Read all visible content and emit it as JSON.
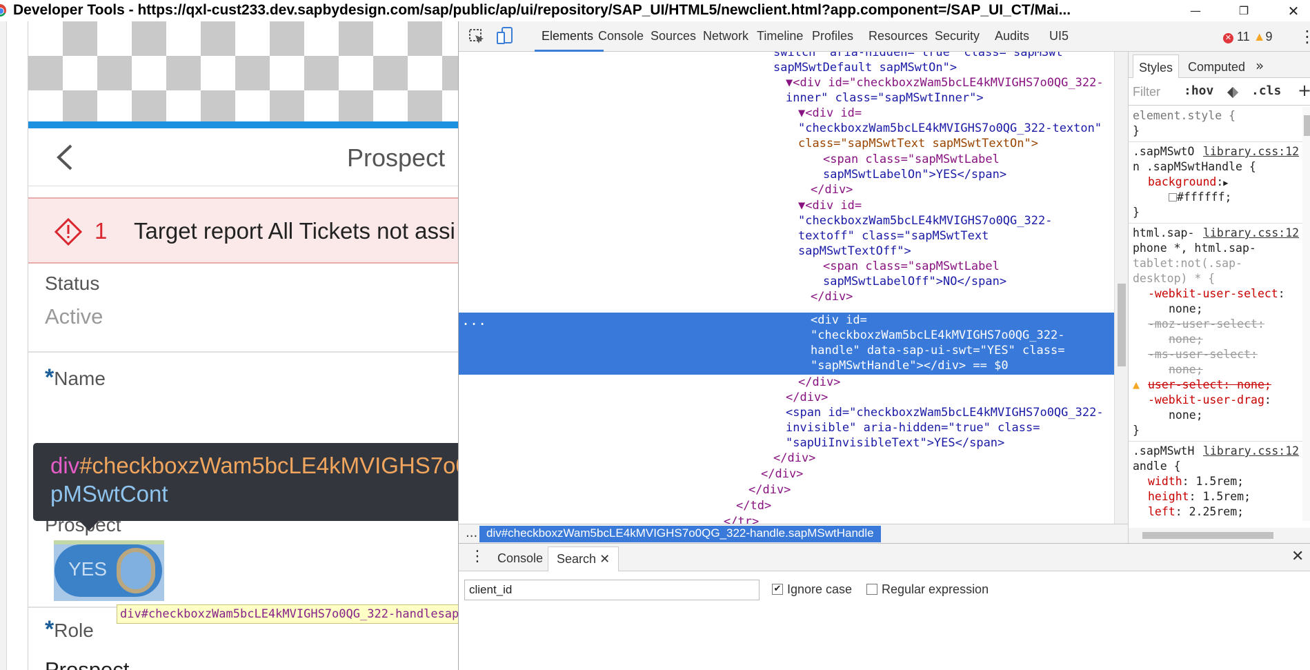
{
  "window": {
    "title": "Developer Tools - https://qxl-cust233.dev.sapbydesign.com/sap/public/ap/ui/repository/SAP_UI/HTML5/newclient.html?app.component=/SAP_UI_CT/Mai...",
    "controls": {
      "minimize": "—",
      "restore": "❐",
      "close": "✕"
    }
  },
  "page": {
    "title": "Prospect",
    "message": {
      "count": "1",
      "text": "Target report All Tickets not assi"
    },
    "fields": [
      {
        "label": "Status",
        "value": "Active"
      },
      {
        "label": "Name",
        "required_mark": "*"
      },
      {
        "label": "Prospect"
      },
      {
        "label": "Role",
        "required_mark": "*",
        "value": "Prospect"
      }
    ],
    "switch": {
      "label": "YES"
    },
    "tooltip": {
      "tag": "div",
      "id": "#checkboxzWam5bcLE4kMVIGHS7o0",
      "class_line": "pMSwtCont"
    },
    "node_label": "div#checkboxzWam5bcLE4kMVIGHS7o0QG_322-handlesap",
    "colors": {
      "accent": "#1b91e0",
      "error": "#d9252d",
      "switch": "#3c82c8"
    }
  },
  "devtools": {
    "tabs": [
      "Elements",
      "Console",
      "Sources",
      "Network",
      "Timeline",
      "Profiles",
      "Resources",
      "Security",
      "Audits",
      "UI5"
    ],
    "active_tab": "Elements",
    "errors": "11",
    "warnings": "9",
    "dom": {
      "l1a": "switch\" aria-hidden=\"true\" class=\"sapMSwt",
      "l1b": "sapMSwtDefault sapMSwtOn\">",
      "l2a": "▼<div id=\"checkboxzWam5bcLE4kMVIGHS7o0QG_322-",
      "l2b": "inner\" class=\"sapMSwtInner\">",
      "l3a": "▼<div id=",
      "l3b": "\"checkboxzWam5bcLE4kMVIGHS7o0QG_322-texton\"",
      "l3c": "class=\"sapMSwtText sapMSwtTextOn\">",
      "l4a": "<span class=\"sapMSwtLabel",
      "l4b": "sapMSwtLabelOn\">YES</span>",
      "l5": "</div>",
      "l6a": "▼<div id=",
      "l6b": "\"checkboxzWam5bcLE4kMVIGHS7o0QG_322-",
      "l6c": "textoff\" class=\"sapMSwtText",
      "l6d": "sapMSwtTextOff\">",
      "l7a": "<span class=\"sapMSwtLabel",
      "l7b": "sapMSwtLabelOff\">NO</span>",
      "l8": "</div>",
      "sel_a": "<div id=",
      "sel_b": "\"checkboxzWam5bcLE4kMVIGHS7o0QG_322-",
      "sel_c": "handle\" data-sap-ui-swt=\"YES\" class=",
      "sel_d": "\"sapMSwtHandle\"></div> == $0",
      "sel_dots": "...",
      "l9": "</div>",
      "l10": "</div>",
      "l11a": "<span id=\"checkboxzWam5bcLE4kMVIGHS7o0QG_322-",
      "l11b": "invisible\" aria-hidden=\"true\" class=",
      "l11c": "\"sapUiInvisibleText\">YES</span>",
      "l12": "</div>",
      "l13": "</div>",
      "l14": "</div>",
      "l15": "</td>",
      "l16": "</tr>"
    },
    "breadcrumb": {
      "dots": "...",
      "item": "div#checkboxzWam5bcLE4kMVIGHS7o0QG_322-handle.sapMSwtHandle"
    },
    "styles": {
      "tabs": [
        "Styles",
        "Computed"
      ],
      "more": "»",
      "filter_placeholder": "Filter",
      "hov": ":hov",
      "cls": ".cls",
      "add": "+",
      "r1a": "element.style {",
      "r1b": "}",
      "r2sel": ".sapMSwtO",
      "r2src": "library.css:12",
      "r2sel2": "n .sapMSwtHandle {",
      "r2pn": "background",
      "r2pv": "#ffffff;",
      "r2end": "}",
      "r3sel": "html.sap-",
      "r3src": "library.css:12",
      "r3b": "phone *, html.sap-",
      "r3c": "tablet:not(.sap-",
      "r3d": "desktop) * {",
      "r3p1": "-webkit-user-select",
      "r3v1": "none;",
      "r3p2": "-moz-user-select:",
      "r3v2": "none;",
      "r3p3": "-ms-user-select:",
      "r3v3": "none;",
      "r3p4": "user-select: none;",
      "r3p5": "-webkit-user-drag",
      "r3v5": "none;",
      "r3end": "}",
      "r4sel": ".sapMSwtH",
      "r4src": "library.css:12",
      "r4b": "andle {",
      "r4p1": "width",
      "r4v1": "1.5rem;",
      "r4p2": "height",
      "r4v2": "1.5rem;",
      "r4p3": "left",
      "r4v3": "2.25rem;"
    },
    "drawer": {
      "tabs": [
        "Console",
        "Search"
      ],
      "search_query": "client_id",
      "ignore_case": "Ignore case",
      "regex": "Regular expression"
    }
  }
}
